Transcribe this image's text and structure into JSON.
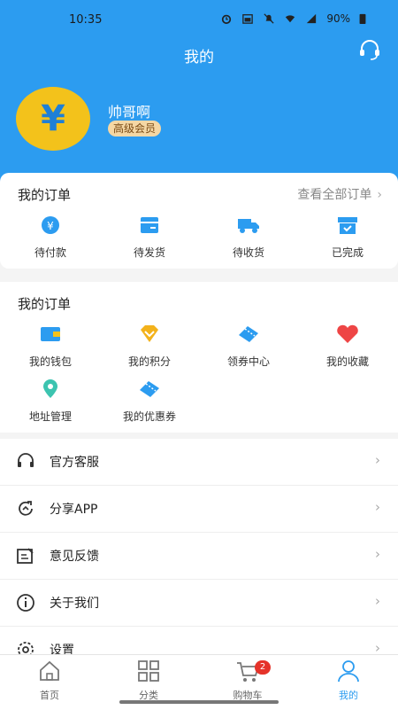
{
  "status_bar": {
    "time": "10:35",
    "battery": "90%"
  },
  "header": {
    "title": "我的"
  },
  "user": {
    "avatar_symbol": "¥",
    "name": "帅哥啊",
    "level": "高级会员"
  },
  "orders": {
    "title": "我的订单",
    "view_all": "查看全部订单",
    "items": [
      {
        "label": "待付款",
        "icon": "yuan-coin-icon"
      },
      {
        "label": "待发货",
        "icon": "package-icon"
      },
      {
        "label": "待收货",
        "icon": "truck-icon"
      },
      {
        "label": "已完成",
        "icon": "box-check-icon"
      }
    ]
  },
  "services": {
    "title": "我的订单",
    "items": [
      {
        "label": "我的钱包",
        "icon": "wallet-icon"
      },
      {
        "label": "我的积分",
        "icon": "gem-icon"
      },
      {
        "label": "领券中心",
        "icon": "ticket-icon"
      },
      {
        "label": "我的收藏",
        "icon": "heart-icon"
      },
      {
        "label": "地址管理",
        "icon": "location-pin-icon"
      },
      {
        "label": "我的优惠券",
        "icon": "coupon-icon"
      }
    ]
  },
  "menu": [
    {
      "label": "官方客服",
      "icon": "headset-icon"
    },
    {
      "label": "分享APP",
      "icon": "share-icon"
    },
    {
      "label": "意见反馈",
      "icon": "feedback-icon"
    },
    {
      "label": "关于我们",
      "icon": "info-icon"
    },
    {
      "label": "设置",
      "icon": "settings-icon"
    }
  ],
  "tabbar": [
    {
      "label": "首页",
      "icon": "home-icon"
    },
    {
      "label": "分类",
      "icon": "grid-icon"
    },
    {
      "label": "购物车",
      "icon": "cart-icon",
      "badge": "2"
    },
    {
      "label": "我的",
      "icon": "user-icon",
      "active": true
    }
  ],
  "colors": {
    "primary": "#2c9cf0",
    "gold": "#f3c21b",
    "badge_red": "#e5332a"
  }
}
